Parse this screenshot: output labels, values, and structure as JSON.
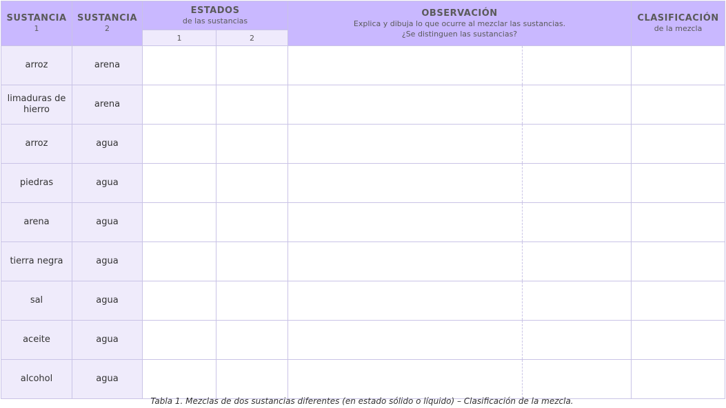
{
  "header": {
    "substance1": {
      "main": "SUSTANCIA",
      "sub": "1"
    },
    "substance2": {
      "main": "SUSTANCIA",
      "sub": "2"
    },
    "states": {
      "main": "ESTADOS",
      "sub": "de las sustancias",
      "col1": "1",
      "col2": "2"
    },
    "observation": {
      "main": "OBSERVACIÓN",
      "sub1": "Explica y dibuja lo que ocurre al mezclar las sustancias.",
      "sub2": "¿Se distinguen las sustancias?"
    },
    "classification": {
      "main": "CLASIFICACIÓN",
      "sub": "de la mezcla"
    }
  },
  "rows": [
    {
      "s1": "arroz",
      "s2": "arena"
    },
    {
      "s1": "limaduras de hierro",
      "s2": "arena"
    },
    {
      "s1": "arroz",
      "s2": "agua"
    },
    {
      "s1": "piedras",
      "s2": "agua"
    },
    {
      "s1": "arena",
      "s2": "agua"
    },
    {
      "s1": "tierra negra",
      "s2": "agua"
    },
    {
      "s1": "sal",
      "s2": "agua"
    },
    {
      "s1": "aceite",
      "s2": "agua"
    },
    {
      "s1": "alcohol",
      "s2": "agua"
    }
  ],
  "caption": "Tabla 1. Mezclas de dos sustancias diferentes (en estado sólido o líquido) – Clasificación de la mezcla.",
  "colors": {
    "header_bg": "#c9b8ff",
    "subheader_bg": "#efeafc",
    "substance_cell_bg": "#efebfb",
    "border": "#c9c3e6"
  }
}
